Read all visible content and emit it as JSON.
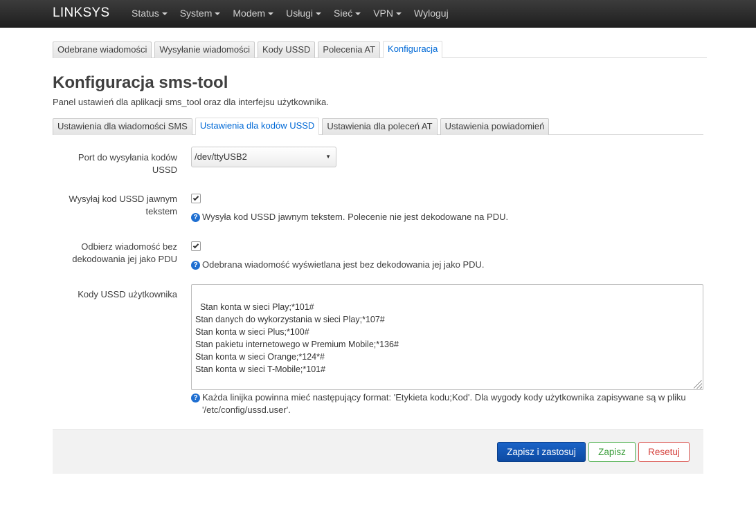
{
  "navbar": {
    "brand": "LINKSYS",
    "items": [
      {
        "label": "Status",
        "dropdown": true
      },
      {
        "label": "System",
        "dropdown": true
      },
      {
        "label": "Modem",
        "dropdown": true
      },
      {
        "label": "Usługi",
        "dropdown": true
      },
      {
        "label": "Sieć",
        "dropdown": true
      },
      {
        "label": "VPN",
        "dropdown": true
      },
      {
        "label": "Wyloguj",
        "dropdown": false
      }
    ]
  },
  "main_tabs": [
    {
      "label": "Odebrane wiadomości",
      "active": false
    },
    {
      "label": "Wysyłanie wiadomości",
      "active": false
    },
    {
      "label": "Kody USSD",
      "active": false
    },
    {
      "label": "Polecenia AT",
      "active": false
    },
    {
      "label": "Konfiguracja",
      "active": true
    }
  ],
  "page": {
    "title": "Konfiguracja sms-tool",
    "description": "Panel ustawień dla aplikacji sms_tool oraz dla interfejsu użytkownika."
  },
  "sub_tabs": [
    {
      "label": "Ustawienia dla wiadomości SMS",
      "active": false
    },
    {
      "label": "Ustawienia dla kodów USSD",
      "active": true
    },
    {
      "label": "Ustawienia dla poleceń AT",
      "active": false
    },
    {
      "label": "Ustawienia powiadomień",
      "active": false
    }
  ],
  "form": {
    "port": {
      "label_line1": "Port do wysyłania kodów",
      "label_line2": "USSD",
      "value": "/dev/ttyUSB2"
    },
    "plain_text": {
      "label_line1": "Wysyłaj kod USSD jawnym",
      "label_line2": "tekstem",
      "checked": true,
      "help": "Wysyła kod USSD jawnym tekstem. Polecenie nie jest dekodowane na PDU."
    },
    "no_pdu": {
      "label_line1": "Odbierz wiadomość bez",
      "label_line2": "dekodowania jej jako PDU",
      "checked": true,
      "help": "Odebrana wiadomość wyświetlana jest bez dekodowania jej jako PDU."
    },
    "user_codes": {
      "label": "Kody USSD użytkownika",
      "value": "Stan konta w sieci Play;*101#\nStan danych do wykorzystania w sieci Play;*107#\nStan konta w sieci Plus;*100#\nStan pakietu internetowego w Premium Mobile;*136#\nStan konta w sieci Orange;*124*#\nStan konta w sieci T-Mobile;*101#",
      "help_line1": "Każda linijka powinna mieć następujący format: 'Etykieta kodu;Kod'. Dla wygody kody użytkownika zapisywane są w pliku",
      "help_line2": "'/etc/config/ussd.user'."
    }
  },
  "actions": {
    "apply": "Zapisz i zastosuj",
    "save": "Zapisz",
    "reset": "Resetuj"
  },
  "colors": {
    "navbar": "#2b2b2b",
    "accent": "#0069d6",
    "apply_button": "#1558b8",
    "save_border": "#4cae4c",
    "reset_border": "#d9534f"
  }
}
